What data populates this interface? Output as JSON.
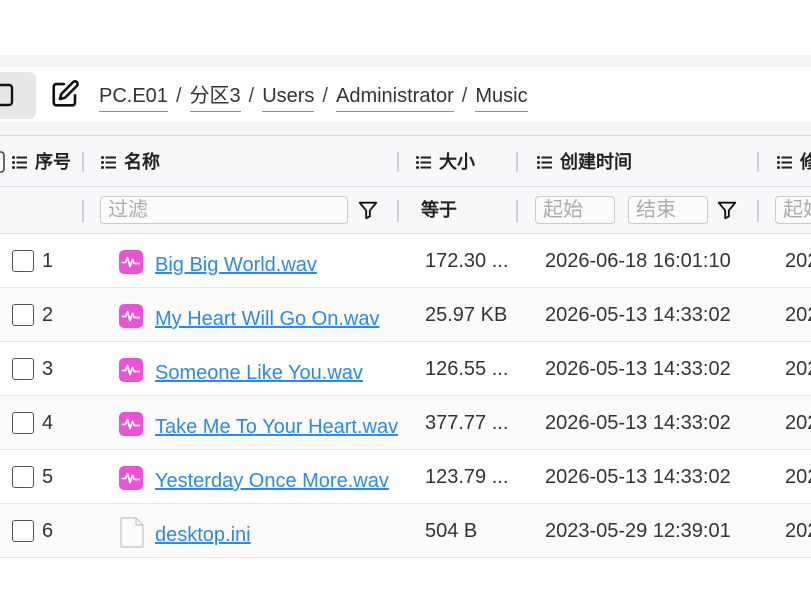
{
  "breadcrumb": {
    "separator": "/",
    "segments": [
      "PC.E01",
      "分区3",
      "Users",
      "Administrator",
      "Music"
    ]
  },
  "toolbar": {
    "left_button_icon": "square-icon",
    "edit_button_icon": "edit-icon"
  },
  "table": {
    "columns": [
      {
        "label": "序号",
        "icon": "list-icon"
      },
      {
        "label": "名称",
        "icon": "list-icon"
      },
      {
        "label": "大小",
        "icon": "list-icon"
      },
      {
        "label": "创建时间",
        "icon": "list-icon"
      },
      {
        "label": "修",
        "icon": "list-icon"
      }
    ],
    "filters": {
      "name_placeholder": "过滤",
      "size_operator": "等于",
      "created_start_placeholder": "起始",
      "created_end_placeholder": "结束",
      "modified_start_placeholder": "起始",
      "filter_icon": "funnel-icon"
    },
    "rows": [
      {
        "selected": false,
        "index": "1",
        "icon": "audio-file-icon",
        "name": "Big Big World.wav",
        "size": "172.30 ...",
        "created": "2026-06-18 16:01:10",
        "modified": "202"
      },
      {
        "selected": false,
        "index": "2",
        "icon": "audio-file-icon",
        "name": "My Heart Will Go On.wav",
        "size": "25.97 KB",
        "created": "2026-05-13 14:33:02",
        "modified": "202"
      },
      {
        "selected": false,
        "index": "3",
        "icon": "audio-file-icon",
        "name": "Someone Like You.wav",
        "size": "126.55 ...",
        "created": "2026-05-13 14:33:02",
        "modified": "202"
      },
      {
        "selected": false,
        "index": "4",
        "icon": "audio-file-icon",
        "name": "Take Me To Your Heart.wav",
        "size": "377.77 ...",
        "created": "2026-05-13 14:33:02",
        "modified": "202"
      },
      {
        "selected": false,
        "index": "5",
        "icon": "audio-file-icon",
        "name": "Yesterday Once More.wav",
        "size": "123.79 ...",
        "created": "2026-05-13 14:33:02",
        "modified": "202"
      },
      {
        "selected": false,
        "index": "6",
        "icon": "file-icon",
        "name": "desktop.ini",
        "size": "504 B",
        "created": "2023-05-29 12:39:01",
        "modified": "202"
      }
    ]
  },
  "colors": {
    "link": "#2a8ae5",
    "audio_icon": "#ec52d6",
    "text": "#333333",
    "header_bg": "#f7f8fa",
    "toolbar_button_bg": "#e7e7e7"
  }
}
